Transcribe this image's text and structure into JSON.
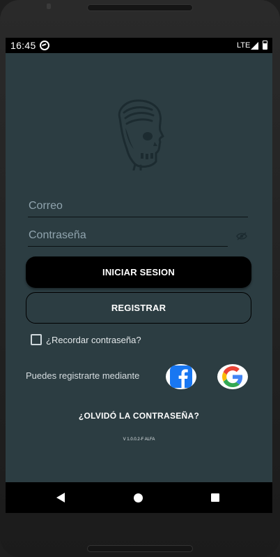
{
  "status_bar": {
    "time": "16:45",
    "network": "LTE"
  },
  "logo": {
    "icon": "bearded-skull-logo"
  },
  "form": {
    "email_placeholder": "Correo",
    "password_placeholder": "Contraseña",
    "login_label": "INICIAR SESION",
    "register_label": "REGISTRAR",
    "remember_label": "¿Recordar contraseña?",
    "remember_checked": false
  },
  "social": {
    "prompt": "Puedes registrarte mediante",
    "providers": [
      "facebook-icon",
      "google-icon"
    ]
  },
  "forgot_label": "¿OLVIDÓ LA CONTRASEÑA?",
  "version": "V 1.0.0.2-F ALFA",
  "colors": {
    "background": "#2c3d42",
    "primary_button": "#000000",
    "text": "#ffffff",
    "facebook": "#1877f2"
  }
}
